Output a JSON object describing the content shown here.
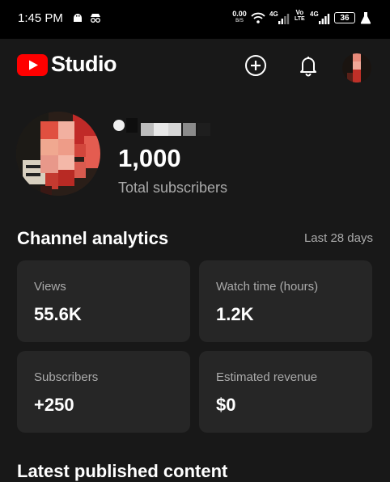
{
  "status_bar": {
    "time": "1:45 PM",
    "net_speed": "0.00",
    "net_unit": "B/S",
    "sig1": "4G",
    "volte": "Vo",
    "volte2": "LTE",
    "sig2": "4G",
    "battery": "36"
  },
  "app_bar": {
    "logo_text": "Studio"
  },
  "channel": {
    "subscriber_count": "1,000",
    "subscriber_label": "Total subscribers"
  },
  "analytics": {
    "title": "Channel analytics",
    "range": "Last 28 days",
    "cards": [
      {
        "label": "Views",
        "value": "55.6K"
      },
      {
        "label": "Watch time (hours)",
        "value": "1.2K"
      },
      {
        "label": "Subscribers",
        "value": "+250"
      },
      {
        "label": "Estimated revenue",
        "value": "$0"
      }
    ]
  },
  "next_section": {
    "title": "Latest published content"
  },
  "colors": {
    "background": "#181818",
    "card": "#262626",
    "brand_red": "#ff0000",
    "secondary_text": "#aaaaaa"
  }
}
